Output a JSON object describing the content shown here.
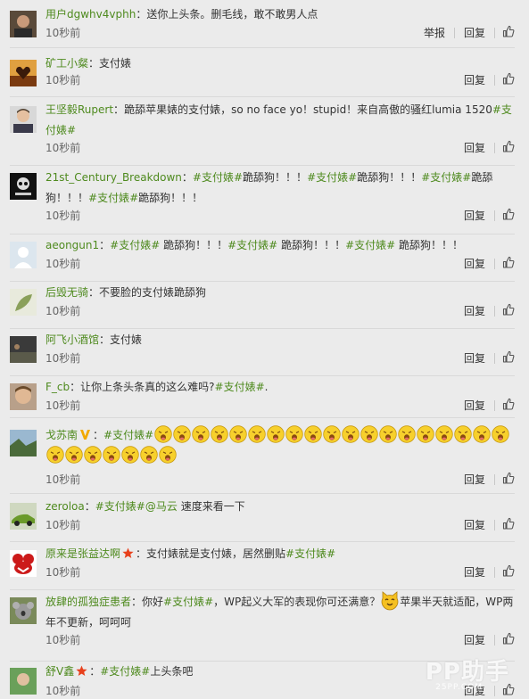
{
  "comments": [
    {
      "user": "用户dgwhv4vphh",
      "parts": [
        {
          "t": "text",
          "v": "送你上头条。删毛线，敢不敢男人点"
        }
      ],
      "time": "10秒前",
      "actions": [
        "举报",
        "回复"
      ],
      "avatar": "avatar-man-dark"
    },
    {
      "user": "矿工小粲",
      "parts": [
        {
          "t": "text",
          "v": "支付婊"
        }
      ],
      "time": "10秒前",
      "actions": [
        "回复"
      ],
      "avatar": "avatar-heart-hands"
    },
    {
      "user": "王坚毅Rupert",
      "parts": [
        {
          "t": "text",
          "v": "跪舔苹果婊的支付婊，so no face yo！stupid！来自高傲的骚红lumia 1520"
        },
        {
          "t": "tag",
          "v": "#支付婊#"
        }
      ],
      "time": "10秒前",
      "actions": [
        "回复"
      ],
      "avatar": "avatar-man-suit"
    },
    {
      "user": "21st_Century_Breakdown",
      "parts": [
        {
          "t": "tag",
          "v": "#支付婊#"
        },
        {
          "t": "text",
          "v": "跪舔狗！！！"
        },
        {
          "t": "tag",
          "v": "#支付婊#"
        },
        {
          "t": "text",
          "v": "跪舔狗！！！"
        },
        {
          "t": "tag",
          "v": "#支付婊#"
        },
        {
          "t": "text",
          "v": "跪舔狗！！！"
        },
        {
          "t": "tag",
          "v": "#支付婊#"
        },
        {
          "t": "text",
          "v": "跪舔狗！！！"
        }
      ],
      "time": "10秒前",
      "actions": [
        "回复"
      ],
      "avatar": "avatar-skull"
    },
    {
      "user": "aeongun1",
      "parts": [
        {
          "t": "tag",
          "v": "#支付婊#"
        },
        {
          "t": "text",
          "v": " 跪舔狗！！！"
        },
        {
          "t": "tag",
          "v": "#支付婊#"
        },
        {
          "t": "text",
          "v": " 跪舔狗！！！"
        },
        {
          "t": "tag",
          "v": "#支付婊#"
        },
        {
          "t": "text",
          "v": " 跪舔狗！！！"
        }
      ],
      "time": "10秒前",
      "actions": [
        "回复"
      ],
      "avatar": "avatar-default"
    },
    {
      "user": "后毁无骑",
      "parts": [
        {
          "t": "text",
          "v": "不要脸的支付婊跪舔狗"
        }
      ],
      "time": "10秒前",
      "actions": [
        "回复"
      ],
      "avatar": "avatar-leaf"
    },
    {
      "user": "阿飞小酒馆",
      "parts": [
        {
          "t": "text",
          "v": "支付婊"
        }
      ],
      "time": "10秒前",
      "actions": [
        "回复"
      ],
      "avatar": "avatar-dark-scene"
    },
    {
      "user": "F_cb",
      "parts": [
        {
          "t": "text",
          "v": "让你上条头条真的这么难吗?"
        },
        {
          "t": "tag",
          "v": "#支付婊#"
        },
        {
          "t": "text",
          "v": "."
        }
      ],
      "time": "10秒前",
      "actions": [
        "回复"
      ],
      "avatar": "avatar-face"
    },
    {
      "user": "戈苏南",
      "vip": true,
      "parts": [
        {
          "t": "tag",
          "v": "#支付婊#"
        },
        {
          "t": "emoji",
          "count": 26
        }
      ],
      "time": "10秒前",
      "actions": [
        "回复"
      ],
      "avatar": "avatar-landscape"
    },
    {
      "user": "zeroloa",
      "parts": [
        {
          "t": "tag",
          "v": "#支付婊#"
        },
        {
          "t": "mention",
          "v": "@马云"
        },
        {
          "t": "text",
          "v": " 速度来看一下"
        }
      ],
      "time": "10秒前",
      "actions": [
        "回复"
      ],
      "avatar": "avatar-car"
    },
    {
      "user": "原来是张益达啊",
      "star": true,
      "parts": [
        {
          "t": "text",
          "v": "支付婊就是支付婊，居然删贴"
        },
        {
          "t": "tag",
          "v": "#支付婊#"
        }
      ],
      "time": "10秒前",
      "actions": [
        "回复"
      ],
      "avatar": "avatar-red-mouse"
    },
    {
      "user": "放肆的孤独症患者",
      "parts": [
        {
          "t": "text",
          "v": "你好"
        },
        {
          "t": "tag",
          "v": "#支付婊#"
        },
        {
          "t": "text",
          "v": "，WP起义大军的表现你可还满意？"
        },
        {
          "t": "catemoji"
        },
        {
          "t": "text",
          "v": "苹果半天就适配，WP两年不更新，呵呵呵"
        }
      ],
      "time": "10秒前",
      "actions": [
        "回复"
      ],
      "avatar": "avatar-koala"
    },
    {
      "user": "舒V鑫",
      "star": true,
      "parts": [
        {
          "t": "tag",
          "v": "#支付婊#"
        },
        {
          "t": "text",
          "v": "上头条吧"
        }
      ],
      "time": "10秒前",
      "actions": [
        "回复"
      ],
      "avatar": "avatar-green"
    }
  ],
  "watermark": {
    "brand": "PP助手",
    "sub": "25PP.COM"
  },
  "colors": {
    "link": "#4e8a1e",
    "background": "#ebebeb",
    "divider": "#d9d9d9"
  }
}
